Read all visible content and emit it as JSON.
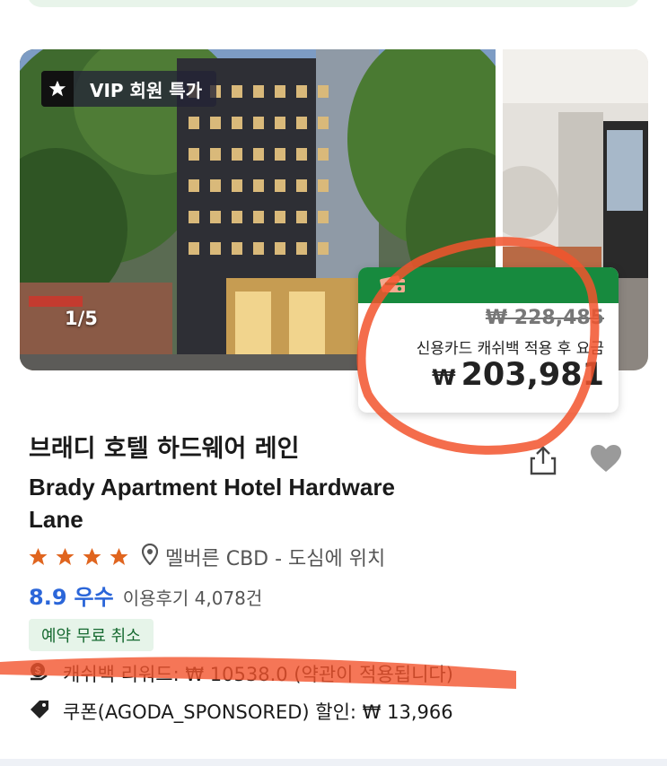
{
  "gallery": {
    "vip_badge": "VIP 회원 특가",
    "counter": "1/5"
  },
  "price_card": {
    "original_price": "₩ 228,485",
    "note": "신용카드 캐쉬백 적용 후 요금",
    "currency": "₩",
    "final_price": "203,981"
  },
  "hotel": {
    "name_ko": "브래디 호텔 하드웨어 레인",
    "name_en": "Brady Apartment Hotel Hardware Lane",
    "stars": 4,
    "location": "멜버른 CBD - 도심에 위치",
    "score": "8.9",
    "score_label": "우수",
    "reviews": "이용후기 4,078건"
  },
  "badges": {
    "free_cancel": "예약 무료 취소"
  },
  "perks": {
    "cashback": "캐쉬백 리워드: ₩ 10538.0 (약관이 적용됩니다)",
    "coupon": "쿠폰(AGODA_SPONSORED) 할인: ₩ 13,966"
  },
  "colors": {
    "accent_green": "#178a3e",
    "star_orange": "#e0651f",
    "score_blue": "#2b66d9",
    "annotation_red": "#f2542d"
  },
  "icons": {
    "vip": "star-icon",
    "share": "share-icon",
    "favorite": "heart-icon",
    "location": "location-pin-icon",
    "cashback": "cashback-coin-icon",
    "coupon": "tag-icon",
    "card": "credit-card-icon"
  }
}
